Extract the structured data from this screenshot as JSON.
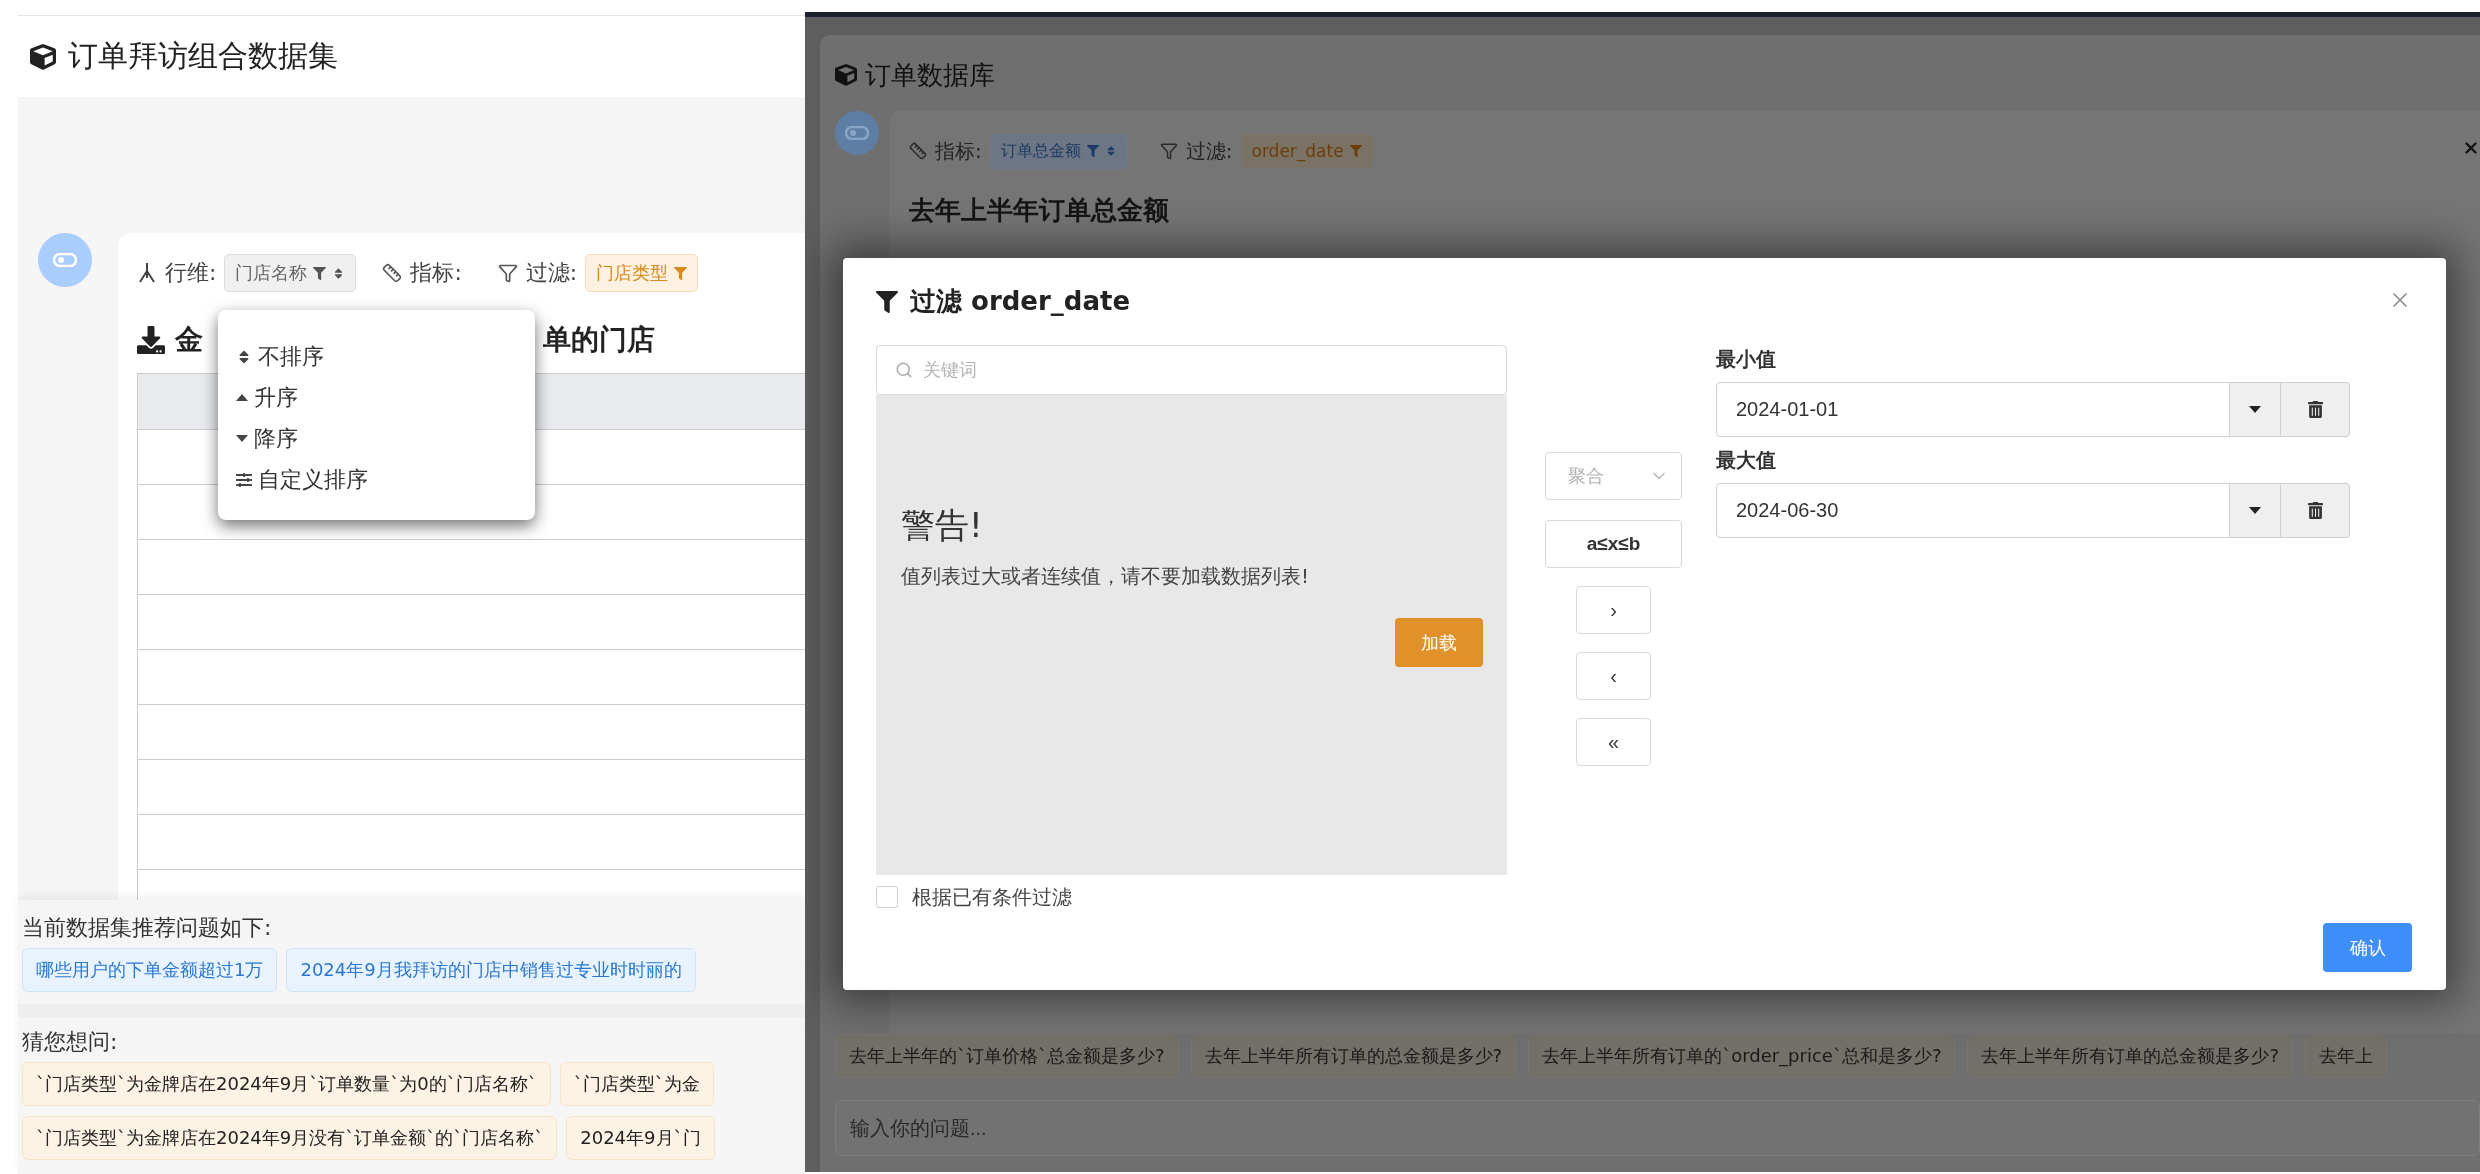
{
  "left_page": {
    "title": "订单拜访组合数据集",
    "toolbar": {
      "row_dim_label": "行维:",
      "row_dim_chip": "门店名称",
      "metric_label": "指标:",
      "filter_label": "过滤:",
      "filter_chip": "门店类型"
    },
    "heading_parts": [
      "金",
      "单的门店"
    ],
    "sort_menu": [
      {
        "label": "不排序",
        "kind": "none"
      },
      {
        "label": "升序",
        "kind": "asc"
      },
      {
        "label": "降序",
        "kind": "desc"
      },
      {
        "label": "自定义排序",
        "kind": "custom"
      }
    ],
    "recommend": {
      "title": "当前数据集推荐问题如下:",
      "chips": [
        "哪些用户的下单金额超过1万",
        "2024年9月我拜访的门店中销售过专业时时丽的"
      ]
    },
    "guess": {
      "title": "猜您想问:",
      "rows": [
        [
          "`门店类型`为金牌店在2024年9月`订单数量`为0的`门店名称`",
          "`门店类型`为金"
        ],
        [
          "`门店类型`为金牌店在2024年9月没有`订单金额`的`门店名称`",
          "2024年9月`门"
        ]
      ]
    }
  },
  "right_page": {
    "title": "订单数据库",
    "toolbar": {
      "metric_label": "指标:",
      "metric_chip": "订单总金额",
      "filter_label": "过滤:",
      "filter_chip": "order_date"
    },
    "heading": "去年上半年订单总金额",
    "suggestions": [
      "去年上半年的`订单价格`总金额是多少?",
      "去年上半年所有订单的总金额是多少?",
      "去年上半年所有订单的`order_price`总和是多少?",
      "去年上半年所有订单的总金额是多少?",
      "去年上"
    ],
    "input": {
      "placeholder": "输入你的问题..."
    }
  },
  "filter_dialog": {
    "title": "过滤 order_date",
    "search": {
      "placeholder": "关键词"
    },
    "warning_title": "警告!",
    "warning_text": "值列表过大或者连续值，请不要加载数据列表!",
    "load_button": "加载",
    "filter_by_existing": {
      "label": "根据已有条件过滤",
      "checked": false
    },
    "aggregate_select": {
      "placeholder": "聚合",
      "disabled": true
    },
    "range_button": "a≤x≤b",
    "move_buttons": [
      "›",
      "‹",
      "«"
    ],
    "min": {
      "label": "最小值",
      "value": "2024-01-01"
    },
    "max": {
      "label": "最大值",
      "value": "2024-06-30"
    },
    "confirm_button": "确认"
  }
}
